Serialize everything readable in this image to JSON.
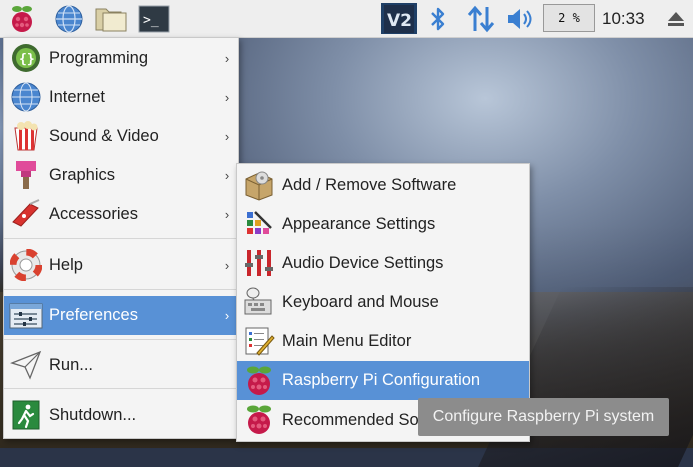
{
  "panel": {
    "clock": "10:33",
    "cpu_usage": "2 %",
    "icons": [
      "raspberry-menu-icon",
      "web-browser-icon",
      "file-manager-icon",
      "terminal-icon",
      "vnc-icon",
      "bluetooth-icon",
      "network-icon",
      "volume-icon",
      "eject-icon"
    ]
  },
  "main_menu": {
    "items": [
      {
        "label": "Programming",
        "icon": "programming-icon"
      },
      {
        "label": "Internet",
        "icon": "internet-icon"
      },
      {
        "label": "Sound & Video",
        "icon": "sound-video-icon"
      },
      {
        "label": "Graphics",
        "icon": "graphics-icon"
      },
      {
        "label": "Accessories",
        "icon": "accessories-icon"
      },
      {
        "label": "Help",
        "icon": "help-icon"
      },
      {
        "label": "Preferences",
        "icon": "preferences-icon"
      },
      {
        "label": "Run...",
        "icon": "run-icon"
      },
      {
        "label": "Shutdown...",
        "icon": "shutdown-icon"
      }
    ],
    "arrow": "›"
  },
  "sub_menu": {
    "items": [
      {
        "label": "Add / Remove Software"
      },
      {
        "label": "Appearance Settings"
      },
      {
        "label": "Audio Device Settings"
      },
      {
        "label": "Keyboard and Mouse"
      },
      {
        "label": "Main Menu Editor"
      },
      {
        "label": "Raspberry Pi Configuration"
      },
      {
        "label": "Recommended Software"
      }
    ]
  },
  "tooltip": {
    "text": "Configure Raspberry Pi system"
  },
  "colors": {
    "highlight": "#5891d6",
    "menu_bg": "#f4f4f4",
    "panel_bg": "#eeeeee",
    "tooltip_bg": "#8c8c8c"
  }
}
